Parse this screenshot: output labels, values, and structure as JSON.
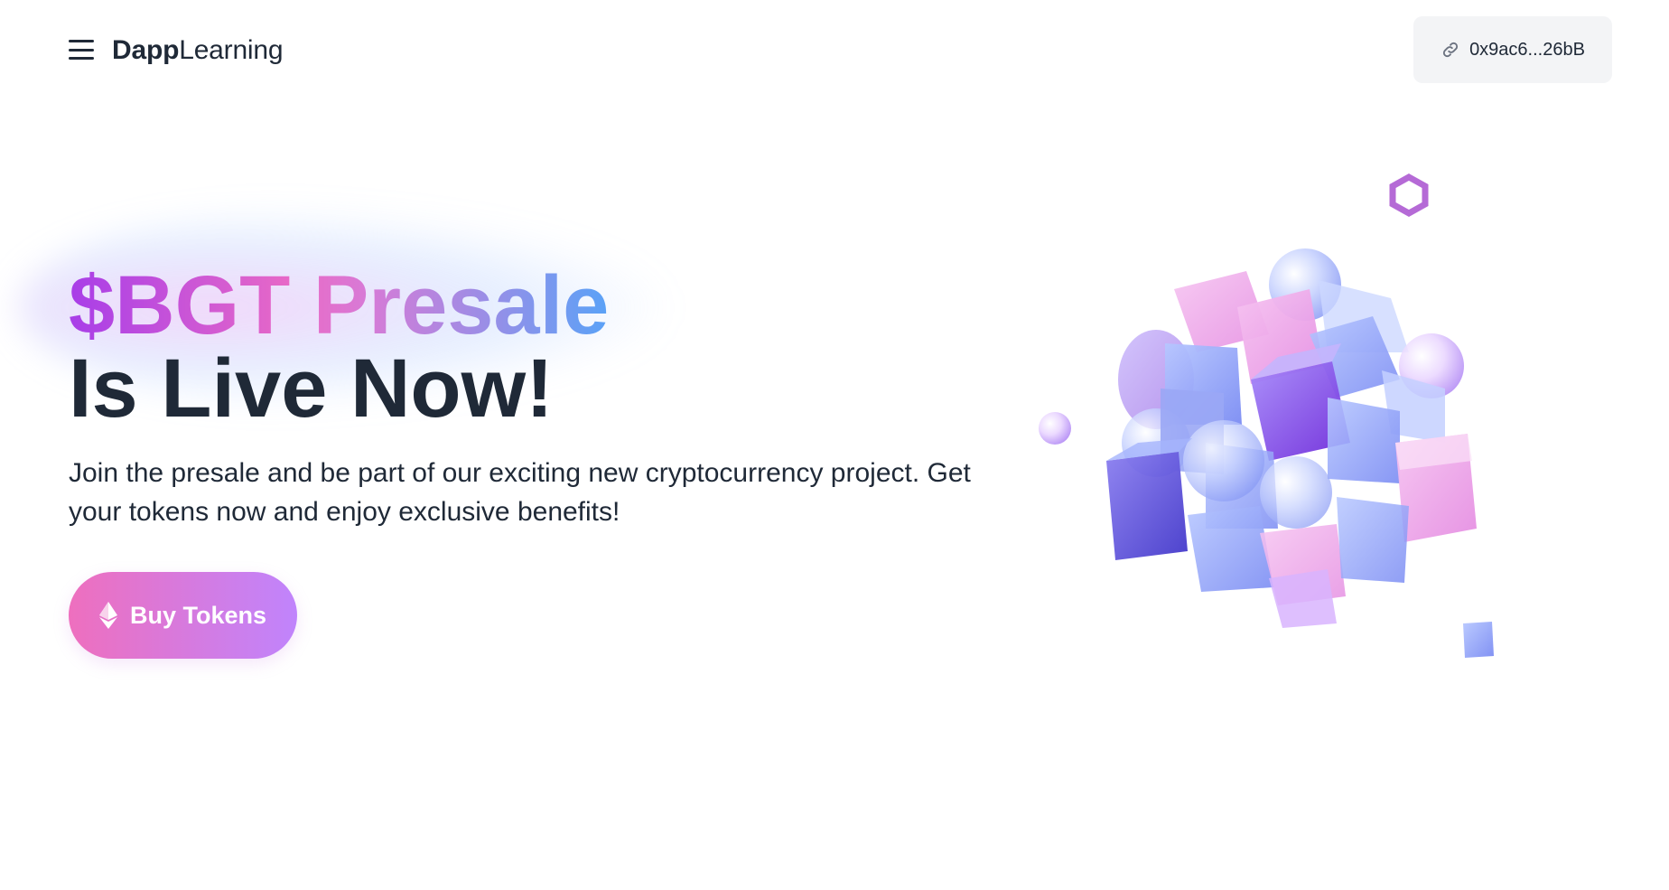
{
  "header": {
    "brand_bold": "Dapp",
    "brand_regular": "Learning",
    "wallet_address": "0x9ac6...26bB",
    "icons": {
      "menu": "hamburger-menu-icon",
      "wallet": "link-icon"
    }
  },
  "hero": {
    "title_line1": "$BGT Presale",
    "title_line2": "Is Live Now!",
    "description": "Join the presale and be part of our exciting new cryptocurrency project. Get your tokens now and enjoy exclusive benefits!",
    "buy_button_label": "Buy Tokens",
    "buy_button_icon": "ethereum-icon",
    "illustration": "crystal-cubes-illustration"
  },
  "colors": {
    "text": "#1f2937",
    "gradient_start": "#a83ee8",
    "gradient_mid": "#e96ac6",
    "gradient_end": "#5aa2f7",
    "button_start": "#ee6fbe",
    "button_end": "#c084fc",
    "wallet_bg": "#f3f4f6"
  }
}
